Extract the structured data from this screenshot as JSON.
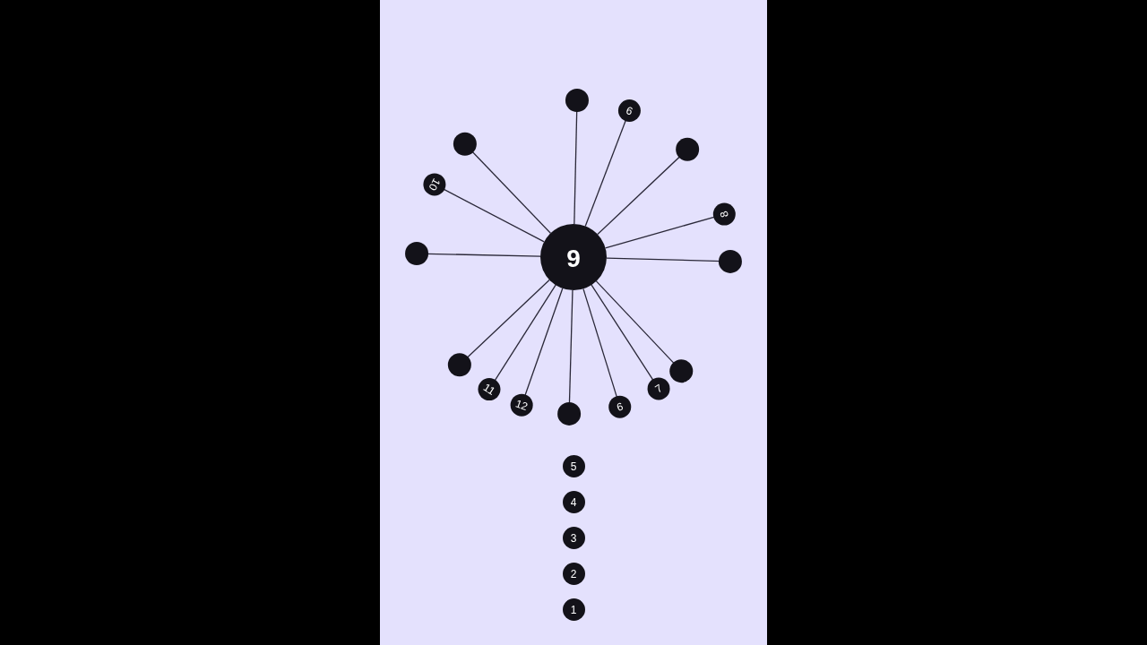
{
  "wheel": {
    "hub_label": "9",
    "pins": [
      {
        "kind": "plain"
      },
      {
        "kind": "numbered",
        "label": "9"
      },
      {
        "kind": "plain"
      },
      {
        "kind": "numbered",
        "label": "8"
      },
      {
        "kind": "plain"
      },
      {
        "kind": "plain"
      },
      {
        "kind": "numbered",
        "label": "7"
      },
      {
        "kind": "numbered",
        "label": "6"
      },
      {
        "kind": "plain"
      },
      {
        "kind": "numbered",
        "label": "12"
      },
      {
        "kind": "numbered",
        "label": "11"
      },
      {
        "kind": "plain"
      },
      {
        "kind": "plain"
      },
      {
        "kind": "numbered",
        "label": "10"
      },
      {
        "kind": "plain"
      }
    ]
  },
  "queue": [
    "5",
    "4",
    "3",
    "2",
    "1"
  ]
}
